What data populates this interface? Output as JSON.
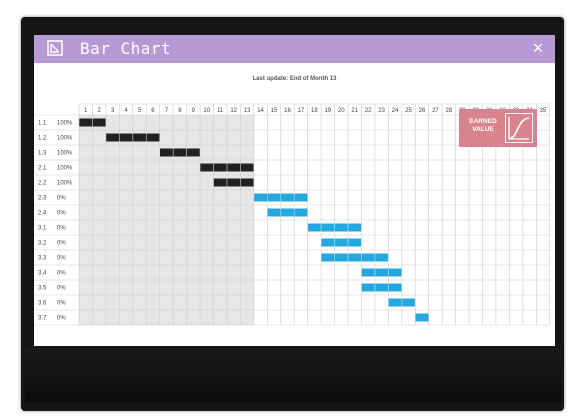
{
  "window": {
    "title": "Bar Chart",
    "close_label": "×",
    "app_icon": "document-icon",
    "close_icon": "close-icon"
  },
  "colors": {
    "titlebar": "#b79ad3",
    "completed_bar": "#222222",
    "planned_bar": "#23a8e0",
    "elapsed_shade": "#e6e6e6",
    "badge": "#d9848c"
  },
  "chart": {
    "last_update": "Last update: End of Month 13",
    "months": [
      "1",
      "2",
      "3",
      "4",
      "5",
      "6",
      "7",
      "8",
      "9",
      "10",
      "11",
      "12",
      "13",
      "14",
      "15",
      "16",
      "17",
      "18",
      "19",
      "20",
      "21",
      "22",
      "23",
      "24",
      "25",
      "26",
      "27",
      "28",
      "29",
      "30",
      "31",
      "32",
      "33",
      "34",
      "35"
    ],
    "elapsed_months": 13
  },
  "badge": {
    "line1": "EARNED",
    "line2": "VALUE"
  },
  "chart_data": {
    "type": "gantt",
    "elapsed_through_month": 13,
    "tasks": [
      {
        "id": "1.1",
        "progress": "100%",
        "start": 1,
        "end": 2,
        "status": "complete"
      },
      {
        "id": "1.2",
        "progress": "100%",
        "start": 3,
        "end": 6,
        "status": "complete"
      },
      {
        "id": "1.3",
        "progress": "100%",
        "start": 7,
        "end": 9,
        "status": "complete"
      },
      {
        "id": "2.1",
        "progress": "100%",
        "start": 10,
        "end": 13,
        "status": "complete"
      },
      {
        "id": "2.2",
        "progress": "100%",
        "start": 11,
        "end": 13,
        "status": "complete"
      },
      {
        "id": "2.3",
        "progress": "0%",
        "start": 14,
        "end": 17,
        "status": "planned"
      },
      {
        "id": "2.4",
        "progress": "0%",
        "start": 15,
        "end": 17,
        "status": "planned"
      },
      {
        "id": "3.1",
        "progress": "0%",
        "start": 18,
        "end": 21,
        "status": "planned"
      },
      {
        "id": "3.2",
        "progress": "0%",
        "start": 19,
        "end": 21,
        "status": "planned"
      },
      {
        "id": "3.3",
        "progress": "0%",
        "start": 19,
        "end": 23,
        "status": "planned"
      },
      {
        "id": "3.4",
        "progress": "0%",
        "start": 22,
        "end": 24,
        "status": "planned"
      },
      {
        "id": "3.5",
        "progress": "0%",
        "start": 22,
        "end": 24,
        "status": "planned"
      },
      {
        "id": "3.6",
        "progress": "0%",
        "start": 24,
        "end": 25,
        "status": "planned"
      },
      {
        "id": "3.7",
        "progress": "0%",
        "start": 26,
        "end": 26,
        "status": "planned"
      }
    ]
  }
}
